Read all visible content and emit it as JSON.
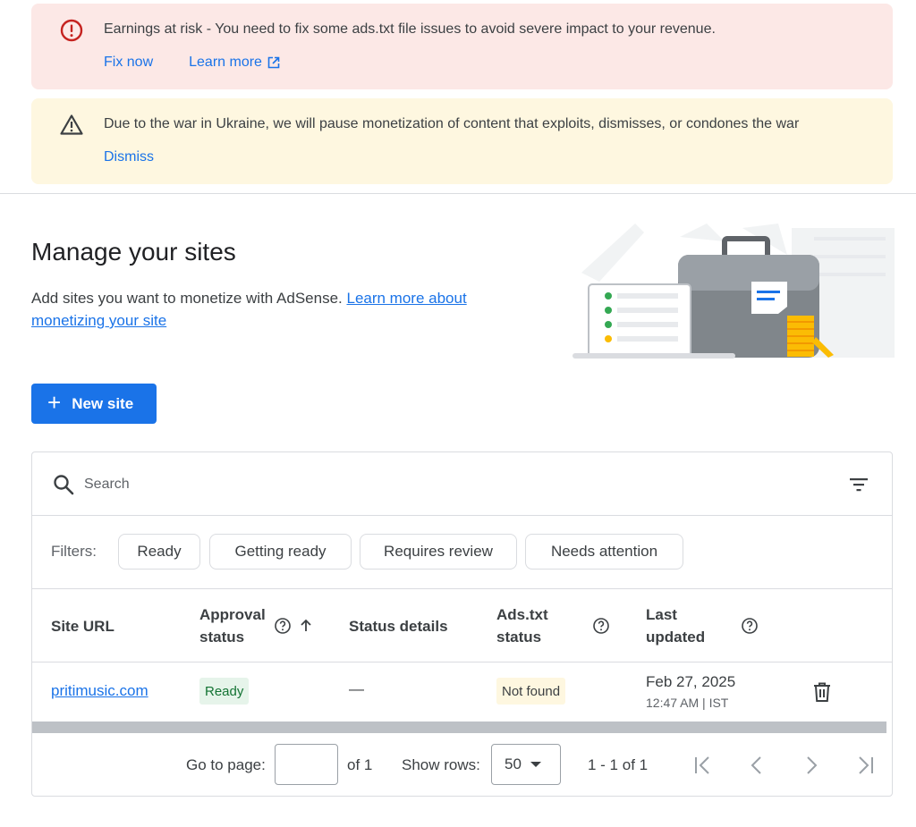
{
  "banners": {
    "error": {
      "message": "Earnings at risk - You need to fix some ads.txt file issues to avoid severe impact to your revenue.",
      "fix_label": "Fix now",
      "learn_label": "Learn more"
    },
    "warning": {
      "message": "Due to the war in Ukraine, we will pause monetization of content that exploits, dismisses, or condones the war",
      "dismiss_label": "Dismiss"
    }
  },
  "header": {
    "title": "Manage your sites",
    "intro_text": "Add sites you want to monetize with AdSense. ",
    "intro_link": "Learn more about monetizing your site"
  },
  "new_site_label": "New site",
  "search": {
    "placeholder": "Search"
  },
  "filters": {
    "label": "Filters:",
    "chips": [
      "Ready",
      "Getting ready",
      "Requires review",
      "Needs attention"
    ]
  },
  "table": {
    "columns": {
      "site_url": "Site URL",
      "approval_1": "Approval",
      "approval_2": "status",
      "status_details": "Status details",
      "adstxt_1": "Ads.txt",
      "adstxt_2": "status",
      "updated_1": "Last",
      "updated_2": "updated"
    },
    "rows": [
      {
        "site": "pritimusic.com",
        "approval": "Ready",
        "details": "—",
        "adstxt": "Not found",
        "date": "Feb 27, 2025",
        "time": "12:47 AM | IST"
      }
    ]
  },
  "pagination": {
    "goto_label": "Go to page:",
    "of_label": "of 1",
    "rows_label": "Show rows:",
    "rows_value": "50",
    "range": "1 - 1 of 1"
  },
  "colors": {
    "accent": "#1a73e8",
    "error_bg": "#fce8e6",
    "warning_bg": "#fef7e0",
    "ready_bg": "#e6f4ea",
    "ready_text": "#137333"
  },
  "icons": [
    "error-icon",
    "warning-icon",
    "open-in-new-icon",
    "plus-icon",
    "search-icon",
    "filter-icon",
    "help-icon",
    "arrow-up-icon",
    "trash-icon",
    "first-page-icon",
    "prev-page-icon",
    "next-page-icon",
    "last-page-icon"
  ]
}
